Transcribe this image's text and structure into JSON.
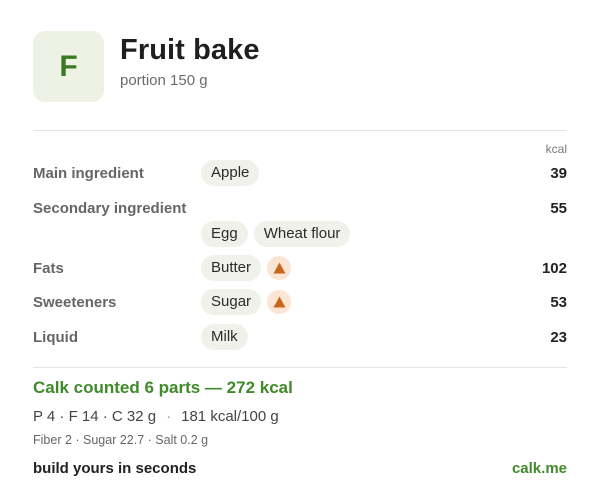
{
  "header": {
    "avatar_letter": "F",
    "title": "Fruit bake",
    "subtitle": "portion 150 g"
  },
  "table": {
    "unit_label": "kcal",
    "rows": [
      {
        "label": "Main ingredient",
        "chips": [
          "Apple"
        ],
        "kcal": "39"
      },
      {
        "label": "Secondary ingredient",
        "chips": [
          "Egg",
          "Wheat flour"
        ],
        "kcal": "55"
      },
      {
        "label": "Fats",
        "chips": [
          "Butter"
        ],
        "warning": "warning-triangle-icon",
        "kcal": "102"
      },
      {
        "label": "Sweeteners",
        "chips": [
          "Sugar"
        ],
        "warning": "warning-triangle-icon",
        "kcal": "53"
      },
      {
        "label": "Liquid",
        "chips": [
          "Milk"
        ],
        "kcal": "23"
      }
    ]
  },
  "summary": {
    "headline": "Calk counted 6 parts — 272 kcal",
    "macros": "P 4 · F 14 · C 32 g",
    "density": "181 kcal/100 g",
    "micros": "Fiber 2 · Sugar 22.7 · Salt 0.2 g"
  },
  "footer": {
    "tagline": "build yours in seconds",
    "link": "calk.me"
  },
  "colors": {
    "accent": "#3f8a2b",
    "warning": "#c8661f",
    "warning_bg": "#fbe6d4"
  }
}
